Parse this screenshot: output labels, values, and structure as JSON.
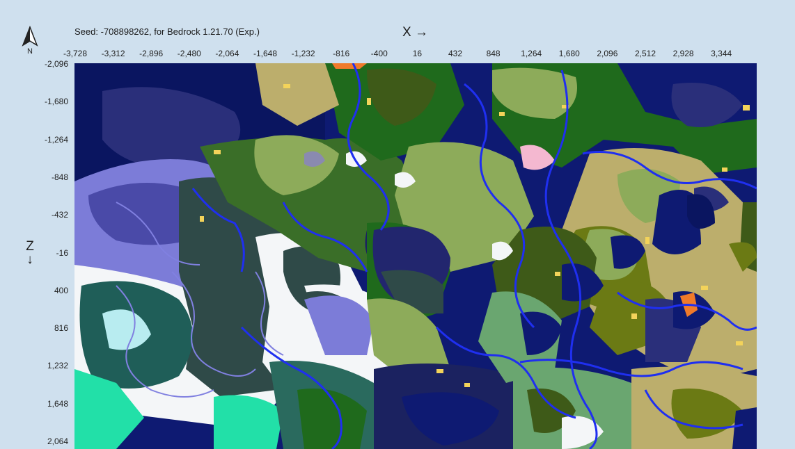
{
  "header": {
    "seed_text": "Seed: -708898262, for Bedrock 1.21.70 (Exp.)",
    "x_axis_title": "X →",
    "z_axis_title_z": "Z",
    "z_axis_title_arrow": "↓",
    "north_label": "N"
  },
  "x_ticks": [
    "-3,728",
    "-3,312",
    "-2,896",
    "-2,480",
    "-2,064",
    "-1,648",
    "-1,232",
    "-816",
    "-400",
    "16",
    "432",
    "848",
    "1,264",
    "1,680",
    "2,096",
    "2,512",
    "2,928",
    "3,344"
  ],
  "z_ticks": [
    "-2,096",
    "-1,680",
    "-1,264",
    "-848",
    "-432",
    "-16",
    "400",
    "816",
    "1,232",
    "1,648",
    "2,064"
  ],
  "map": {
    "colors": {
      "deep_ocean": "#0e1a72",
      "dark_ocean": "#2a2f7a",
      "ocean": "#1e2c9a",
      "river": "#1f2ff0",
      "snowy_plains": "#f4f6f8",
      "snowy_taiga": "#2f4a48",
      "frozen": "#7c7cd8",
      "taiga": "#2a6a5e",
      "forest": "#1f6a1c",
      "dark_forest": "#3e5a18",
      "plains": "#8dab5a",
      "meadow": "#6aa670",
      "savanna": "#bcae6c",
      "swamp": "#6b7a14",
      "desert": "#f3d35a",
      "badlands": "#f07a2a",
      "cherry_grove": "#f4b8d0",
      "mushroom_teal": "#22e0a8",
      "ice_peaks": "#b8ecf0"
    }
  }
}
